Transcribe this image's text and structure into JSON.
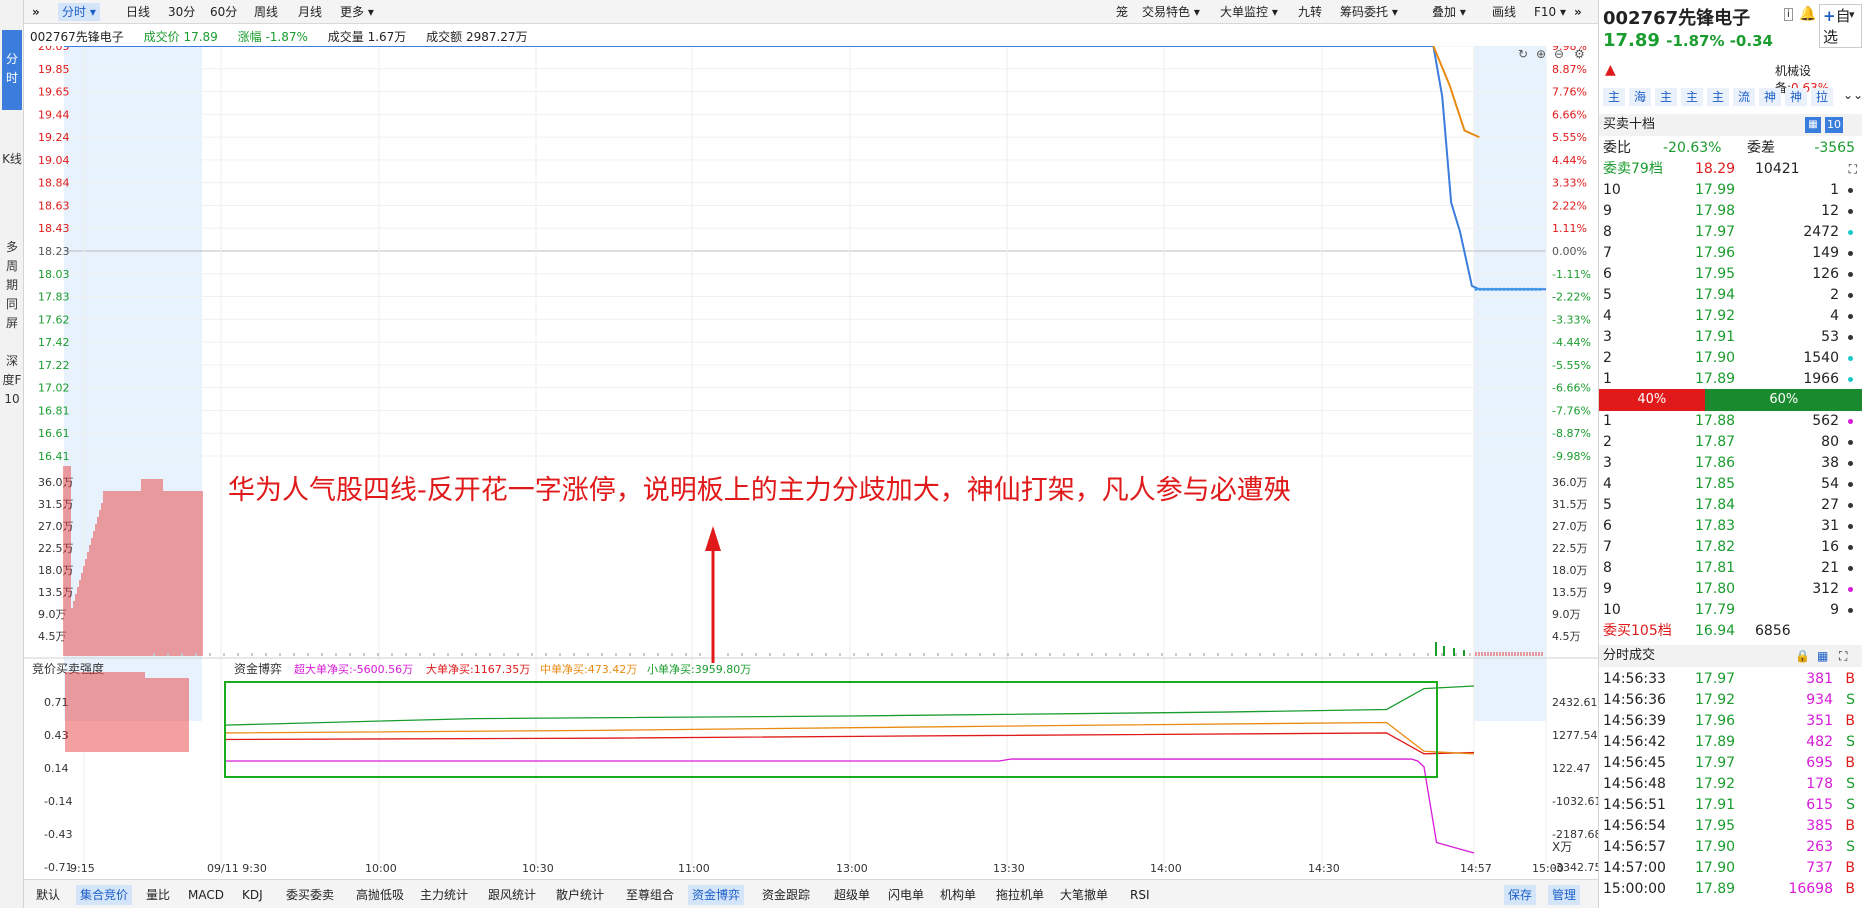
{
  "vtabs": [
    "分时",
    "K线",
    "多周期同屏",
    "深度F10"
  ],
  "topbar": {
    "periods": [
      "分时",
      "日线",
      "30分",
      "60分",
      "周线",
      "月线",
      "更多"
    ],
    "tools": [
      "笼",
      "交易特色",
      "大单监控",
      "九转",
      "筹码委托",
      "叠加",
      "画线",
      "F10"
    ]
  },
  "info": {
    "name": "002767先锋电子",
    "price": "成交价 17.89",
    "change": "涨幅 -1.87%",
    "volume": "成交量 1.67万",
    "amount": "成交额 2987.27万"
  },
  "chart_data": [
    {
      "type": "line",
      "name": "price",
      "y_left_ticks": [
        "20.05",
        "19.85",
        "19.65",
        "19.44",
        "19.24",
        "19.04",
        "18.84",
        "18.63",
        "18.43",
        "18.23",
        "18.03",
        "17.83",
        "17.62",
        "17.42",
        "17.22",
        "17.02",
        "16.81",
        "16.61",
        "16.41"
      ],
      "y_right_ticks": [
        "9.98%",
        "8.87%",
        "7.76%",
        "6.66%",
        "5.55%",
        "4.44%",
        "3.33%",
        "2.22%",
        "1.11%",
        "0.00%",
        "-1.11%",
        "-2.22%",
        "-3.33%",
        "-4.44%",
        "-5.55%",
        "-6.66%",
        "-7.76%",
        "-8.87%",
        "-9.98%"
      ],
      "ylim": [
        16.41,
        20.05
      ],
      "series": [
        {
          "name": "price",
          "color": "#3b7ddd",
          "points": [
            [
              0,
              20.05
            ],
            [
              0.924,
              20.05
            ],
            [
              0.93,
              19.6
            ],
            [
              0.936,
              18.66
            ],
            [
              0.942,
              18.4
            ],
            [
              0.95,
              17.92
            ],
            [
              0.955,
              17.89
            ],
            [
              1.0,
              17.89
            ]
          ]
        },
        {
          "name": "avg",
          "color": "#e88a10",
          "points": [
            [
              0.924,
              20.05
            ],
            [
              0.935,
              19.7
            ],
            [
              0.945,
              19.3
            ],
            [
              0.955,
              19.24
            ]
          ]
        }
      ]
    },
    {
      "type": "bar",
      "name": "volume",
      "y_ticks": [
        "36.0万",
        "31.5万",
        "27.0万",
        "22.5万",
        "18.0万",
        "13.5万",
        "9.0万",
        "4.5万"
      ]
    },
    {
      "type": "line",
      "name": "资金博弈",
      "left_ticks": [
        "0.71",
        "0.43",
        "0.14",
        "-0.14",
        "-0.43",
        "-0.71"
      ],
      "right_ticks": [
        "2432.61",
        "1277.54",
        "122.47",
        "-1032.61",
        "-2187.68",
        "-3342.75"
      ],
      "ylim": [
        -3900,
        3000
      ],
      "series": [
        {
          "name": "超大单净买",
          "value": "-5600.56万",
          "color": "#d81ad8",
          "points": [
            [
              0,
              125
            ],
            [
              0.62,
              125
            ],
            [
              0.63,
              200
            ],
            [
              0.95,
              200
            ],
            [
              0.955,
              125
            ],
            [
              0.96,
              -100
            ],
            [
              0.97,
              -3000
            ],
            [
              1,
              -3400
            ]
          ]
        },
        {
          "name": "大单净买",
          "value": "1167.35万",
          "color": "#e01a1a",
          "points": [
            [
              0,
              950
            ],
            [
              0.3,
              1000
            ],
            [
              0.6,
              1100
            ],
            [
              0.93,
              1200
            ],
            [
              0.96,
              400
            ],
            [
              1,
              450
            ]
          ]
        },
        {
          "name": "中单净买",
          "value": "473.42万",
          "color": "#e88a10",
          "points": [
            [
              0,
              1200
            ],
            [
              0.3,
              1300
            ],
            [
              0.7,
              1500
            ],
            [
              0.93,
              1600
            ],
            [
              0.96,
              500
            ],
            [
              1,
              400
            ]
          ]
        },
        {
          "name": "小单净买",
          "value": "3959.80万",
          "color": "#1a9c2e",
          "points": [
            [
              0,
              1500
            ],
            [
              0.2,
              1750
            ],
            [
              0.5,
              1850
            ],
            [
              0.8,
              2000
            ],
            [
              0.93,
              2100
            ],
            [
              0.96,
              2900
            ],
            [
              1,
              3000
            ]
          ]
        }
      ]
    },
    {
      "type": "axis",
      "x_ticks": [
        "9:15",
        "09/11 9:30",
        "10:00",
        "10:30",
        "11:00",
        "13:00",
        "13:30",
        "14:00",
        "14:30",
        "14:57",
        "15:00"
      ]
    }
  ],
  "subchart": {
    "label_left": "竞价买卖强度",
    "label_right": "资金博弈",
    "unit": "X万"
  },
  "annotation": "华为人气股四线-反开花一字涨停，说明板上的主力分歧加大，神仙打架，凡人参与必遭殃",
  "bottombar": [
    "默认",
    "集合竞价",
    "量比",
    "MACD",
    "KDJ",
    "委买委卖",
    "高抛低吸",
    "主力统计",
    "跟风统计",
    "散户统计",
    "至尊组合",
    "资金博弈",
    "资金跟踪",
    "超级单",
    "闪电单",
    "机构单",
    "拖拉机单",
    "大笔撤单",
    "RSI"
  ],
  "bottom_right": [
    "保存",
    "管理"
  ],
  "right": {
    "code": "002767先锋电子",
    "watch": "自选",
    "price": "17.89",
    "chg": "-1.87% -0.34",
    "industry": "机械设备:",
    "industry_val": "0.63%",
    "tags": [
      "主",
      "海",
      "主",
      "主",
      "主",
      "流",
      "神",
      "神",
      "拉"
    ],
    "book_title": "买卖十档",
    "book_num": "10",
    "weibi_label": "委比",
    "weibi": "-20.63%",
    "weicha_label": "委差",
    "weicha": "-3565",
    "ask_total": [
      "委卖79档",
      "18.29",
      "10421"
    ],
    "asks": [
      [
        "10",
        "17.99",
        "1"
      ],
      [
        "9",
        "17.98",
        "12"
      ],
      [
        "8",
        "17.97",
        "2472"
      ],
      [
        "7",
        "17.96",
        "149"
      ],
      [
        "6",
        "17.95",
        "126"
      ],
      [
        "5",
        "17.94",
        "2"
      ],
      [
        "4",
        "17.92",
        "4"
      ],
      [
        "3",
        "17.91",
        "53"
      ],
      [
        "2",
        "17.90",
        "1540"
      ],
      [
        "1",
        "17.89",
        "1966"
      ]
    ],
    "ratio": [
      "40%",
      "60%"
    ],
    "bids": [
      [
        "1",
        "17.88",
        "562"
      ],
      [
        "2",
        "17.87",
        "80"
      ],
      [
        "3",
        "17.86",
        "38"
      ],
      [
        "4",
        "17.85",
        "54"
      ],
      [
        "5",
        "17.84",
        "27"
      ],
      [
        "6",
        "17.83",
        "31"
      ],
      [
        "7",
        "17.82",
        "16"
      ],
      [
        "8",
        "17.81",
        "21"
      ],
      [
        "9",
        "17.80",
        "312"
      ],
      [
        "10",
        "17.79",
        "9"
      ]
    ],
    "bid_total": [
      "委买105档",
      "16.94",
      "6856"
    ],
    "trades_title": "分时成交",
    "trades": [
      [
        "14:56:33",
        "17.97",
        "381",
        "B"
      ],
      [
        "14:56:36",
        "17.92",
        "934",
        "S"
      ],
      [
        "14:56:39",
        "17.96",
        "351",
        "B"
      ],
      [
        "14:56:42",
        "17.89",
        "482",
        "S"
      ],
      [
        "14:56:45",
        "17.97",
        "695",
        "B"
      ],
      [
        "14:56:48",
        "17.92",
        "178",
        "S"
      ],
      [
        "14:56:51",
        "17.91",
        "615",
        "S"
      ],
      [
        "14:56:54",
        "17.95",
        "385",
        "B"
      ],
      [
        "14:56:57",
        "17.90",
        "263",
        "S"
      ],
      [
        "14:57:00",
        "17.90",
        "737",
        "B"
      ],
      [
        "15:00:00",
        "17.89",
        "16698",
        "B"
      ]
    ]
  }
}
